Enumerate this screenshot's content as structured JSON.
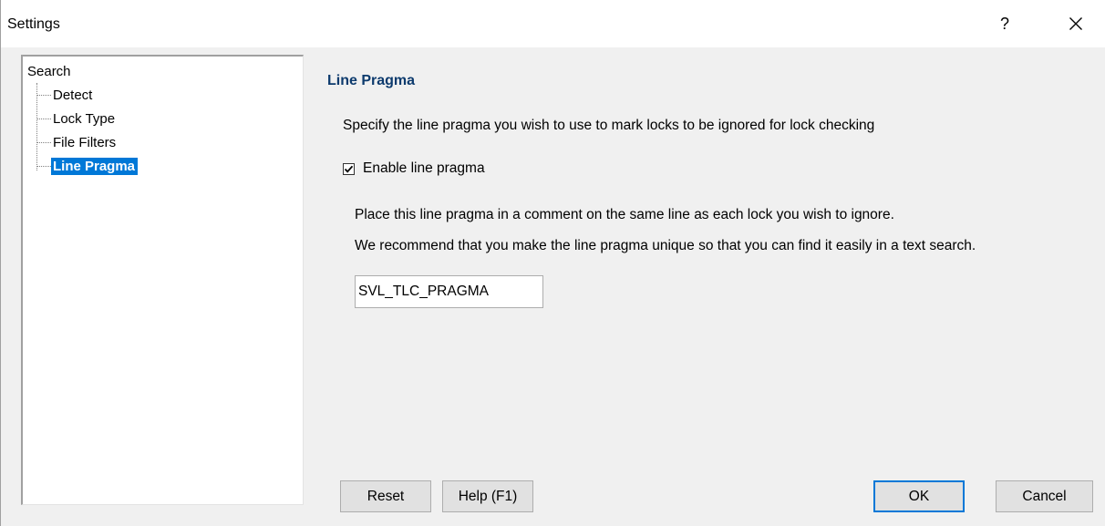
{
  "window": {
    "title": "Settings",
    "help_glyph": "?",
    "close_icon": "close-icon"
  },
  "tree": {
    "root": "Search",
    "items": [
      {
        "label": "Detect",
        "selected": false
      },
      {
        "label": "Lock Type",
        "selected": false
      },
      {
        "label": "File Filters",
        "selected": false
      },
      {
        "label": "Line Pragma",
        "selected": true
      }
    ]
  },
  "panel": {
    "title": "Line Pragma",
    "description": "Specify the line pragma you wish to use to mark locks to be ignored for lock checking",
    "checkbox_label": "Enable line pragma",
    "checkbox_checked": true,
    "info_line1": "Place this line pragma in a comment on the same line as each lock you wish to ignore.",
    "info_line2": "We recommend that you make the line pragma unique so that you can find it easily in a text search.",
    "pragma_value": "SVL_TLC_PRAGMA"
  },
  "buttons": {
    "reset": "Reset",
    "help": "Help (F1)",
    "ok": "OK",
    "cancel": "Cancel"
  },
  "colors": {
    "selection": "#0078d7",
    "section_title": "#0c3a6d",
    "default_button_border": "#0078d7"
  }
}
